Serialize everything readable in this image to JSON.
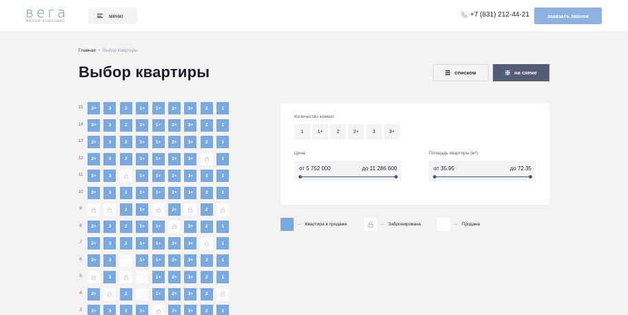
{
  "header": {
    "logo_main": "вега",
    "logo_sub": "жилой комплекс",
    "menu_label": "меню",
    "phone": "+7 (831) 212-44-21",
    "cta_label": "заказать звонок"
  },
  "breadcrumb": {
    "home": "Главная",
    "separator": "•",
    "current": "Выбор Квартиры"
  },
  "page_title": "Выбор квартиры",
  "view_toggle": {
    "list_label": "списком",
    "scheme_label": "на схеме",
    "active": "scheme"
  },
  "lock_glyph": "🔒",
  "floors": [
    {
      "floor": "15",
      "cells": [
        [
          "sale",
          "2+"
        ],
        [
          "sale",
          "3"
        ],
        [
          "sale",
          "2"
        ],
        [
          "sale",
          "1+"
        ],
        [
          "sale",
          "1+"
        ],
        [
          "sale",
          "2+"
        ],
        [
          "sale",
          "3+"
        ],
        [
          "sale",
          "2"
        ],
        [
          "sale",
          "1"
        ]
      ]
    },
    {
      "floor": "14",
      "cells": [
        [
          "sale",
          "2+"
        ],
        [
          "sale",
          "3"
        ],
        [
          "sale",
          "2"
        ],
        [
          "sale",
          "1+"
        ],
        [
          "sale",
          "1+"
        ],
        [
          "sale",
          "2+"
        ],
        [
          "sale",
          "3+"
        ],
        [
          "sale",
          "2"
        ],
        [
          "sale",
          "1"
        ]
      ]
    },
    {
      "floor": "13",
      "cells": [
        [
          "sale",
          "2+"
        ],
        [
          "sale",
          "3"
        ],
        [
          "sale",
          "2"
        ],
        [
          "sale",
          "1+"
        ],
        [
          "sale",
          "1+"
        ],
        [
          "sale",
          "2+"
        ],
        [
          "sale",
          "3+"
        ],
        [
          "sale",
          "2"
        ],
        [
          "sale",
          "1"
        ]
      ]
    },
    {
      "floor": "12",
      "cells": [
        [
          "sale",
          "2+"
        ],
        [
          "sale",
          "3"
        ],
        [
          "sale",
          "2"
        ],
        [
          "sale",
          "1+"
        ],
        [
          "sale",
          "1+"
        ],
        [
          "sale",
          "2+"
        ],
        [
          "sale",
          "3+"
        ],
        [
          "reserved",
          ""
        ],
        [
          "sale",
          "1"
        ]
      ]
    },
    {
      "floor": "11",
      "cells": [
        [
          "sale",
          "2+"
        ],
        [
          "sale",
          "3"
        ],
        [
          "reserved",
          ""
        ],
        [
          "sale",
          "1+"
        ],
        [
          "sale",
          "1+"
        ],
        [
          "sale",
          "2+"
        ],
        [
          "sale",
          "3+"
        ],
        [
          "sale",
          "2"
        ],
        [
          "sale",
          "1"
        ]
      ]
    },
    {
      "floor": "10",
      "cells": [
        [
          "sale",
          "2+"
        ],
        [
          "sale",
          "3"
        ],
        [
          "sale",
          "2"
        ],
        [
          "sale",
          "1+"
        ],
        [
          "sale",
          "1+"
        ],
        [
          "sale",
          "2+"
        ],
        [
          "sale",
          "3+"
        ],
        [
          "sale",
          "2"
        ],
        [
          "sale",
          "1"
        ]
      ]
    },
    {
      "floor": "9",
      "cells": [
        [
          "reserved",
          ""
        ],
        [
          "reserved",
          ""
        ],
        [
          "sale",
          "2"
        ],
        [
          "sale",
          "1+"
        ],
        [
          "reserved",
          ""
        ],
        [
          "sale",
          "2+"
        ],
        [
          "reserved",
          ""
        ],
        [
          "sale",
          "2"
        ],
        [
          "reserved",
          ""
        ]
      ]
    },
    {
      "floor": "8",
      "cells": [
        [
          "sale",
          "2+"
        ],
        [
          "sale",
          "3"
        ],
        [
          "sale",
          "2"
        ],
        [
          "sale",
          "1+"
        ],
        [
          "sale",
          "1+"
        ],
        [
          "reserved",
          ""
        ],
        [
          "sale",
          "3+"
        ],
        [
          "sale",
          "2"
        ],
        [
          "sale",
          "1"
        ]
      ]
    },
    {
      "floor": "7",
      "cells": [
        [
          "sale",
          "2+"
        ],
        [
          "sale",
          "3"
        ],
        [
          "sale",
          "2"
        ],
        [
          "sale",
          "1+"
        ],
        [
          "sale",
          "1+"
        ],
        [
          "sale",
          "2+"
        ],
        [
          "sale",
          "3+"
        ],
        [
          "reserved",
          ""
        ],
        [
          "sale",
          "1"
        ]
      ]
    },
    {
      "floor": "6",
      "cells": [
        [
          "sale",
          "2+"
        ],
        [
          "sale",
          "3"
        ],
        [
          "sold",
          ""
        ],
        [
          "sale",
          "1+"
        ],
        [
          "sale",
          "1+"
        ],
        [
          "sale",
          "2+"
        ],
        [
          "sale",
          "3+"
        ],
        [
          "sale",
          "2"
        ],
        [
          "sale",
          "1"
        ]
      ]
    },
    {
      "floor": "5",
      "cells": [
        [
          "reserved",
          ""
        ],
        [
          "sale",
          "3"
        ],
        [
          "reserved",
          ""
        ],
        [
          "sold",
          ""
        ],
        [
          "sale",
          "1+"
        ],
        [
          "sale",
          "2+"
        ],
        [
          "sale",
          "3+"
        ],
        [
          "sale",
          "2"
        ],
        [
          "sale",
          "1"
        ]
      ]
    },
    {
      "floor": "4",
      "cells": [
        [
          "sale",
          "2+"
        ],
        [
          "reserved",
          ""
        ],
        [
          "sale",
          "2"
        ],
        [
          "sold",
          ""
        ],
        [
          "sale",
          "1+"
        ],
        [
          "sale",
          "2+"
        ],
        [
          "sale",
          "3+"
        ],
        [
          "sale",
          "2"
        ],
        [
          "reserved",
          ""
        ]
      ]
    },
    {
      "floor": "3",
      "cells": [
        [
          "sale",
          "2+"
        ],
        [
          "sale",
          "3"
        ],
        [
          "sale",
          "2"
        ],
        [
          "sale",
          "1+"
        ],
        [
          "reserved",
          ""
        ],
        [
          "sale",
          "2+"
        ],
        [
          "sale",
          "3+"
        ],
        [
          "sale",
          "2"
        ],
        [
          "sale",
          "1"
        ]
      ]
    }
  ],
  "filters": {
    "rooms_label": "Количество комнат",
    "rooms": [
      "1",
      "1+",
      "2",
      "2+",
      "3",
      "3+"
    ],
    "price_label": "Цена",
    "price_from": "от 5 752 000",
    "price_to": "до 11 286 600",
    "area_label": "Площадь квартиры (м²)",
    "area_from": "от 35.95",
    "area_to": "до 72.35"
  },
  "legend": {
    "sale_label": "Квартира в продаже",
    "reserved_label": "Забронирована",
    "sold_label": "Продана",
    "dash": "—"
  },
  "colors": {
    "accent": "#7aa9df",
    "dark_button": "#535d78",
    "cta": "#8db2e2"
  }
}
